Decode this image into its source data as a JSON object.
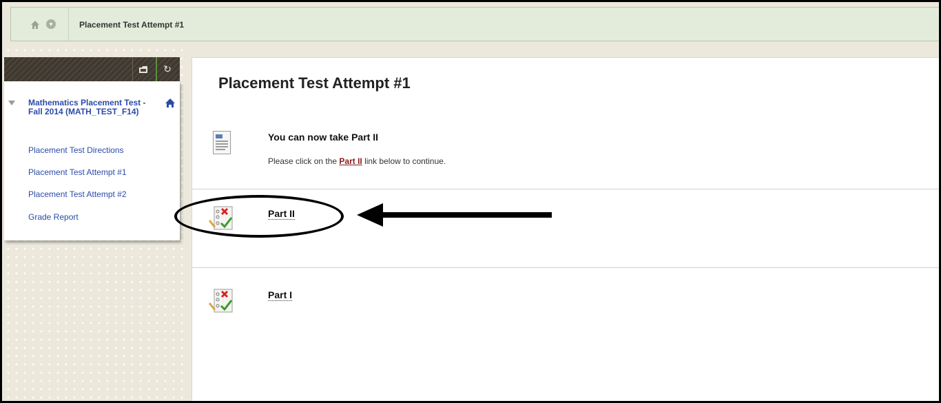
{
  "breadcrumb": {
    "home_icon": "home-icon",
    "menu_icon": "chevron-down-icon",
    "current": "Placement Test Attempt #1"
  },
  "sidebar": {
    "tools": [
      "folder-icon",
      "refresh-icon"
    ],
    "course": {
      "title": "Mathematics Placement Test - Fall 2014 (MATH_TEST_F14)",
      "home_icon": "home-icon"
    },
    "items": [
      {
        "label": "Placement Test Directions"
      },
      {
        "label": "Placement Test Attempt #1"
      },
      {
        "label": "Placement Test Attempt #2"
      },
      {
        "label": "Grade Report"
      }
    ]
  },
  "content": {
    "title": "Placement Test Attempt #1",
    "items": [
      {
        "icon": "document-icon",
        "title": "You can now take Part II",
        "desc_before": "Please click on the ",
        "desc_link": "Part II",
        "desc_after": " link below to continue."
      },
      {
        "icon": "test-icon",
        "title": "Part II"
      },
      {
        "icon": "test-icon",
        "title": "Part I"
      }
    ]
  },
  "colors": {
    "link": "#2b4ba8",
    "breadcrumb_bg": "#e3ecda",
    "inline_link": "#8b1a1a",
    "annotation": "#000000"
  }
}
